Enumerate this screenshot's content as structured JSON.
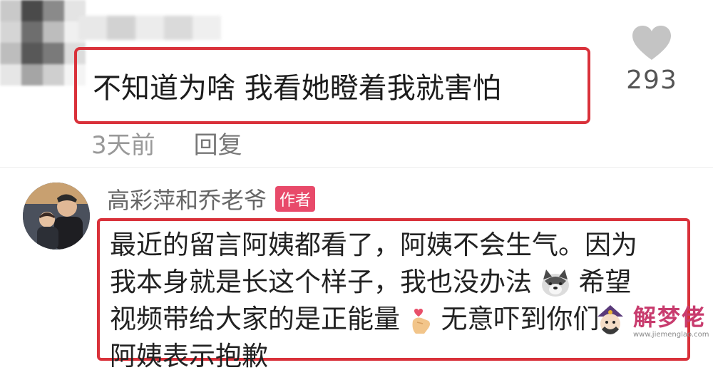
{
  "comment": {
    "text": "不知道为啥 我看她瞪着我就害怕",
    "time": "3天前",
    "reply_label": "回复",
    "likes": "293"
  },
  "author_reply": {
    "name": "高彩萍和乔老爷",
    "badge": "作者",
    "lines": [
      "最近的留言阿姨都看了，阿姨不会生气。因为",
      "我本身就是长这个样子，我也没办法",
      "希望",
      "视频带给大家的是正能量",
      "无意吓到你们",
      "阿姨表示抱歉"
    ]
  },
  "watermark": {
    "title": "解梦佬",
    "url": "www.jiemenglao.com"
  },
  "icons": [
    "heart-icon",
    "dog-emoji",
    "finger-heart-emoji",
    "watermark-logo"
  ],
  "colors": {
    "highlight_border": "#d9313a",
    "badge": "#e84a6a"
  }
}
